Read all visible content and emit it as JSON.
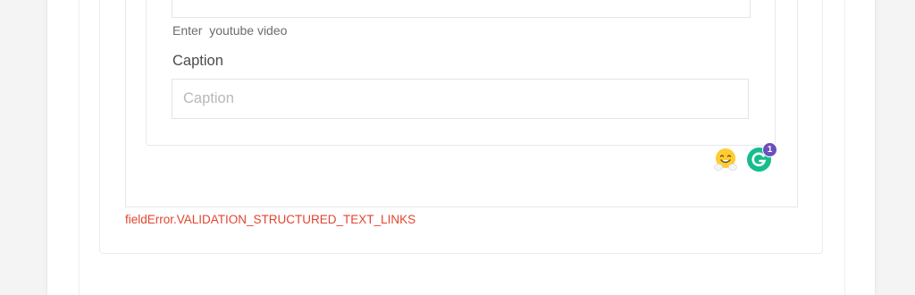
{
  "video_field": {
    "help_text": "Enter  youtube video"
  },
  "caption_field": {
    "label": "Caption",
    "placeholder": "Caption",
    "value": ""
  },
  "widgets": {
    "emoji_icon": "hugging-face-emoji",
    "grammarly_icon": "grammarly-g",
    "grammarly_badge_count": "1",
    "grammarly_color": "#15bd8c",
    "badge_color": "#6b4fbb"
  },
  "validation": {
    "error_text": "fieldError.VALIDATION_STRUCTURED_TEXT_LINKS",
    "error_color": "#e2442f"
  }
}
